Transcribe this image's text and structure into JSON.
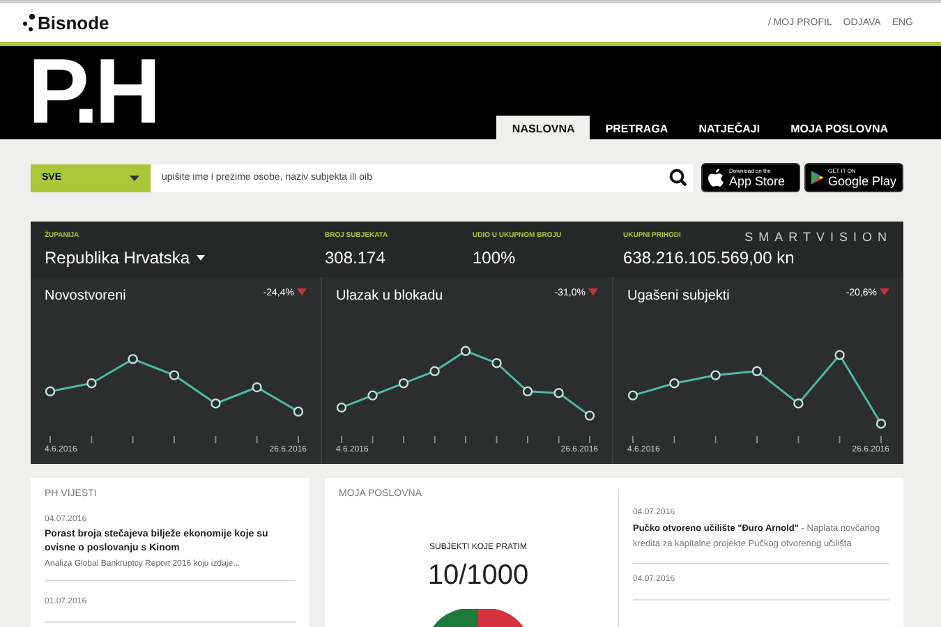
{
  "top_bar": {
    "logo": "Bisnode",
    "links": [
      "/ MOJ PROFIL",
      "ODJAVA",
      "ENG"
    ]
  },
  "header": {
    "brand": "P.H",
    "tabs": [
      {
        "label": "NASLOVNA",
        "selected": true
      },
      {
        "label": "PRETRAGA",
        "selected": false
      },
      {
        "label": "NATJEČAJI",
        "selected": false
      },
      {
        "label": "MOJA POSLOVNA",
        "selected": false
      }
    ]
  },
  "search": {
    "category": "SVE",
    "placeholder": "upišite ime i prezime osobe, naziv subjekta ili oib"
  },
  "store_buttons": [
    {
      "small": "Download on the",
      "label": "App Store",
      "kind": "apple"
    },
    {
      "small": "GET IT ON",
      "label": "Google Play",
      "kind": "google"
    }
  ],
  "stats": {
    "brand": "SMARTVISION",
    "items": [
      {
        "label": "ŽUPANIJA",
        "value": "Republika Hrvatska",
        "kind": "dropdown"
      },
      {
        "label": "BROJ SUBJEKATA",
        "value": "308.174",
        "kind": "plain"
      },
      {
        "label": "UDIO U UKUPNOM BROJU",
        "value": "100%",
        "kind": "plain"
      },
      {
        "label": "UKUPNI PRIHODI",
        "value": "638.216.105.569,00 kn",
        "kind": "plain"
      }
    ]
  },
  "trend_panels": [
    {
      "title": "Novostvoreni",
      "change": "-24,4%",
      "start": "4.6.2016",
      "end": "26.6.2016"
    },
    {
      "title": "Ulazak u blokadu",
      "change": "-31,0%",
      "start": "4.6.2016",
      "end": "26.6.2016"
    },
    {
      "title": "Ugašeni subjekti",
      "change": "-20,6%",
      "start": "4.6.2016",
      "end": "26.6.2016"
    }
  ],
  "news": {
    "title": "PH VIJESTI",
    "items": [
      {
        "date": "04.07.2016",
        "headline": "Porast broja stečajeva bilježe ekonomije koje su ovisne o poslovanju s Kinom",
        "summary": "Analiza Global Bankruptcy Report 2016 koju izdaje..."
      },
      {
        "date": "01.07.2016"
      }
    ]
  },
  "portfolio": {
    "title": "MOJA POSLOVNA",
    "counter_label": "SUBJEKTI KOJE PRATIM",
    "counter": "10/1000",
    "items": [
      {
        "date": "04.07.2016",
        "text": "**Pučko otvoreno učilište \"Đuro Arnold\"** - Naplata novčanog kredita za kapitalne projekte Pučkog otvorenog učilišta"
      },
      {
        "date": "04.07.2016"
      }
    ]
  }
}
